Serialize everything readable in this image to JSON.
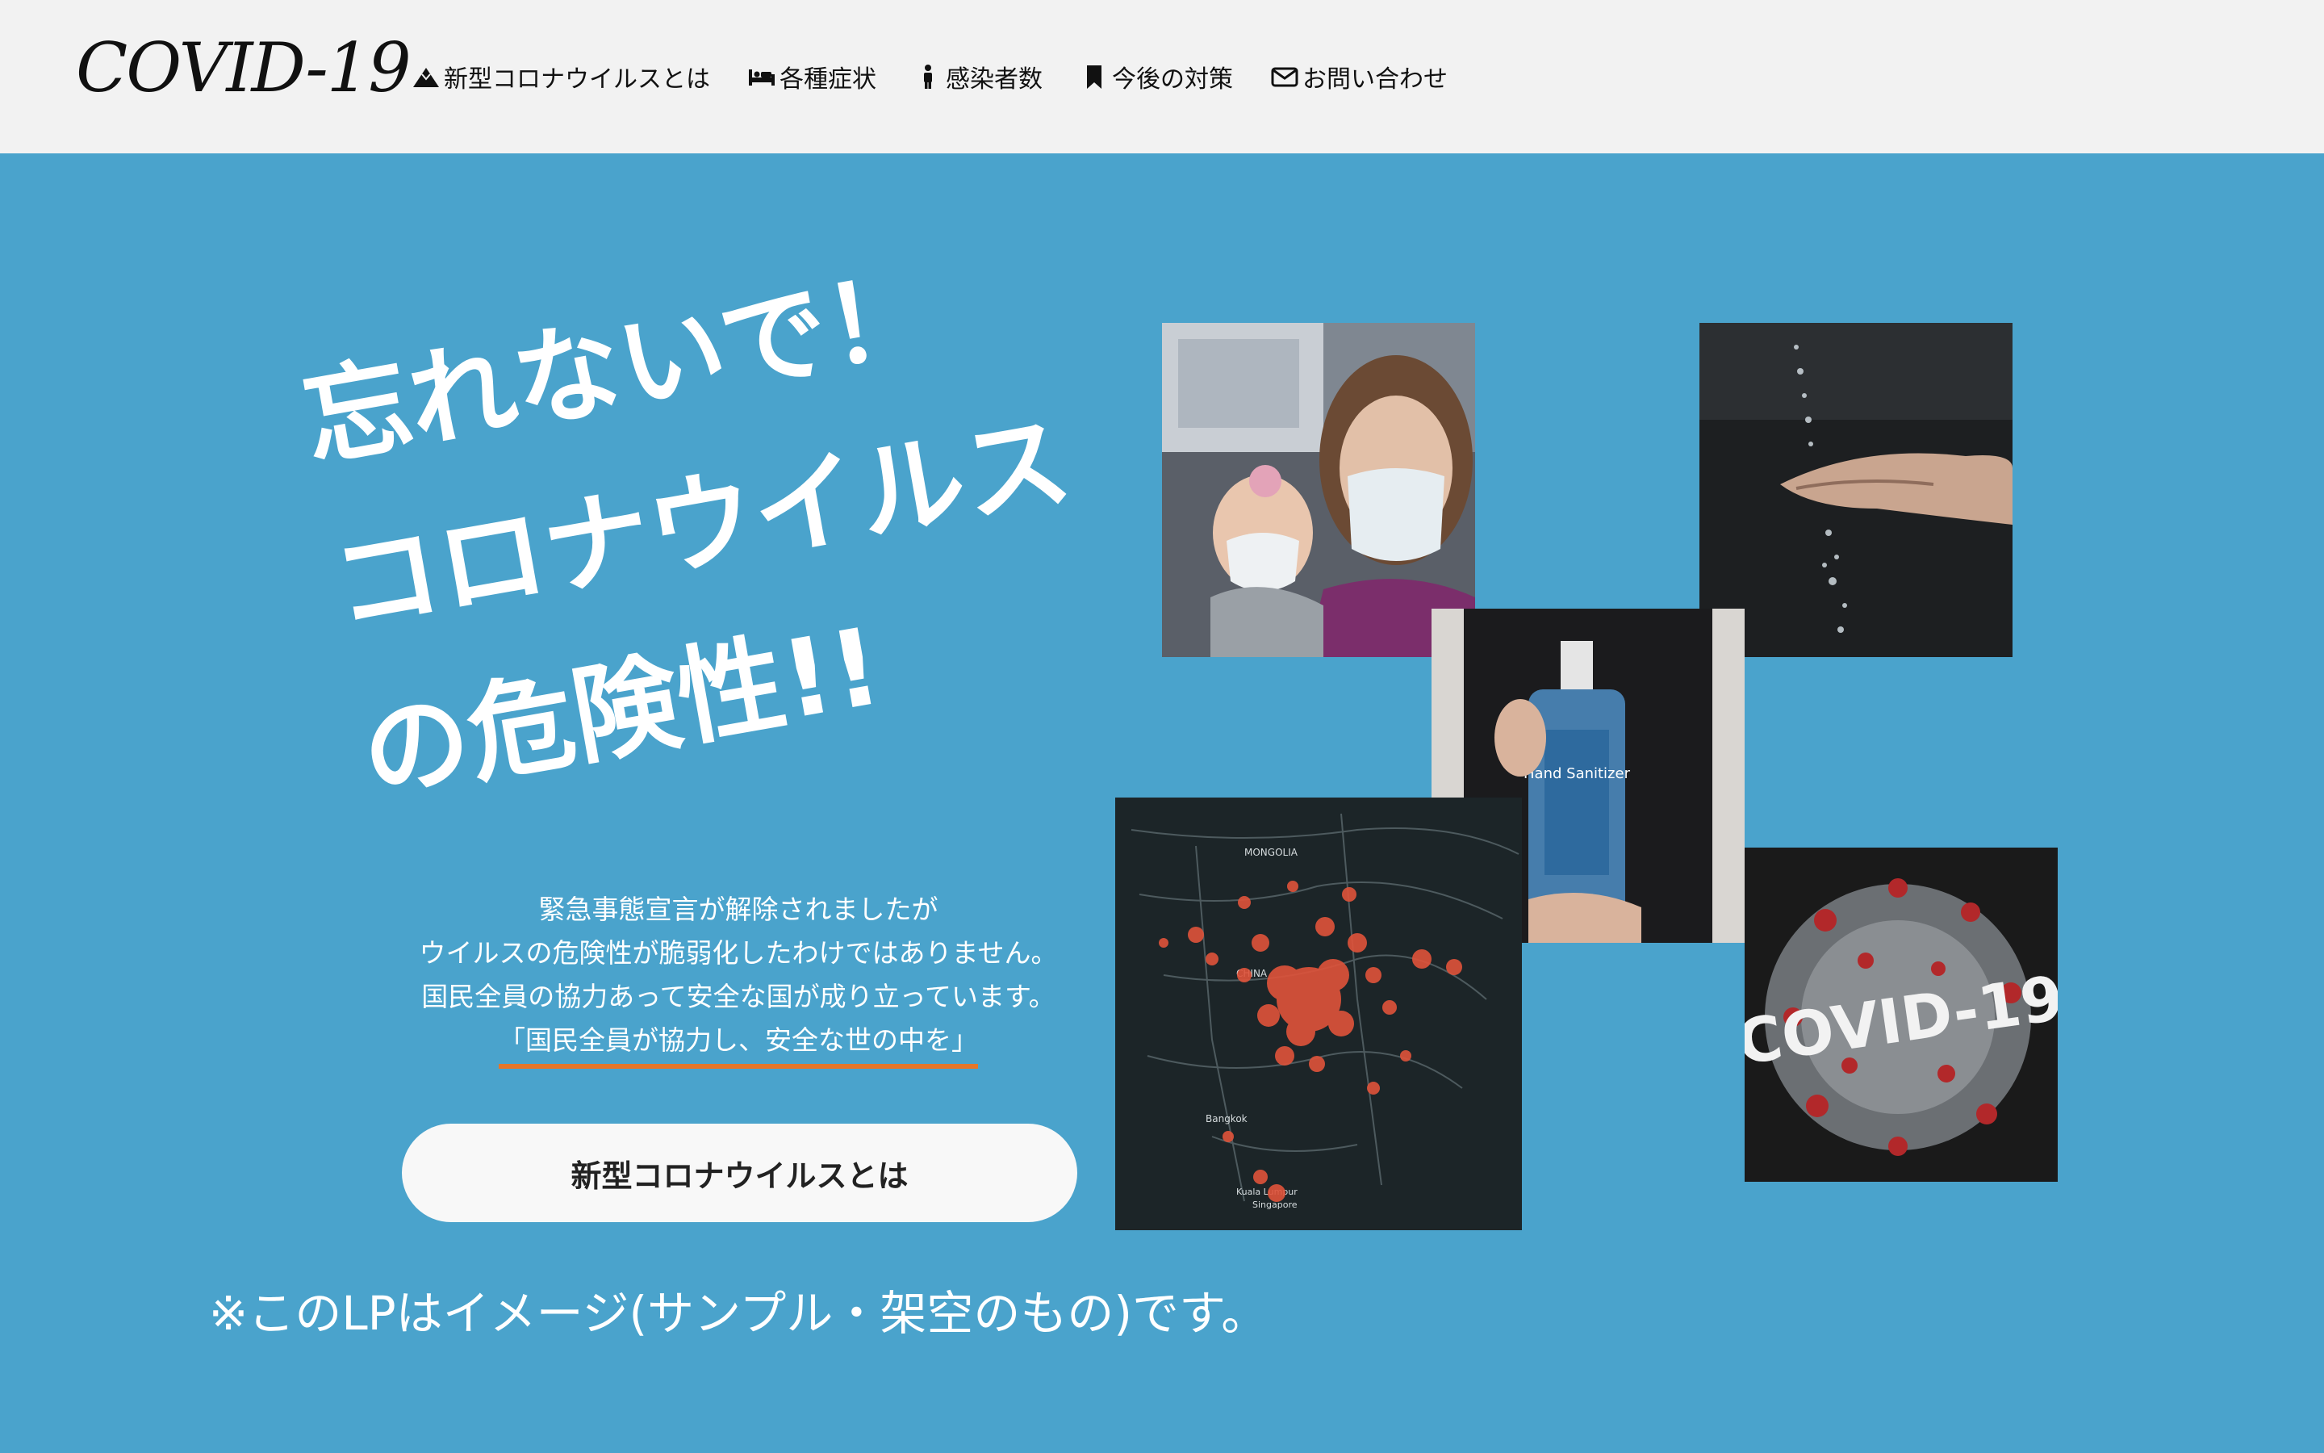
{
  "header": {
    "logo": "COVID-19",
    "nav": [
      {
        "label": "新型コロナウイルスとは",
        "icon": "mountain-icon"
      },
      {
        "label": "各種症状",
        "icon": "bed-icon"
      },
      {
        "label": "感染者数",
        "icon": "person-icon"
      },
      {
        "label": "今後の対策",
        "icon": "bookmark-icon"
      },
      {
        "label": "お問い合わせ",
        "icon": "envelope-icon"
      }
    ]
  },
  "hero": {
    "headline": [
      "忘れないで！",
      "コロナウイルス",
      "の危険性!!"
    ],
    "lead": [
      "緊急事態宣言が解除されましたが",
      "ウイルスの危険性が脆弱化したわけではありません。",
      "国民全員の協力あって安全な国が成り立っています。"
    ],
    "lead_emphasis": "「国民全員が協力し、安全な世の中を」",
    "cta_label": "新型コロナウイルスとは",
    "note": "※このLPはイメージ(サンプル・架空のもの)です。"
  },
  "photos": {
    "sanitizer_label": "Hand Sanitizer",
    "map_labels": [
      "MONGOLIA",
      "CHINA",
      "Bangkok",
      "Kuala Lumpur",
      "Singapore"
    ],
    "covid_text": "COVID-19"
  },
  "colors": {
    "background": "#4aa3cc",
    "header": "#f2f2f2",
    "accent_underline": "#e5762a"
  }
}
